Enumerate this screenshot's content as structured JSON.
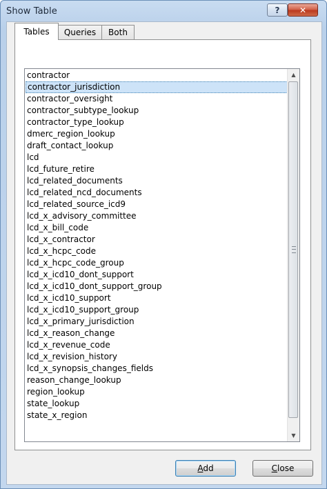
{
  "window": {
    "title": "Show Table",
    "help_glyph": "?",
    "close_glyph": "✕"
  },
  "tabs": [
    {
      "label": "Tables",
      "active": true
    },
    {
      "label": "Queries",
      "active": false
    },
    {
      "label": "Both",
      "active": false
    }
  ],
  "list": {
    "selected_index": 1,
    "items": [
      "contractor",
      "contractor_jurisdiction",
      "contractor_oversight",
      "contractor_subtype_lookup",
      "contractor_type_lookup",
      "dmerc_region_lookup",
      "draft_contact_lookup",
      "lcd",
      "lcd_future_retire",
      "lcd_related_documents",
      "lcd_related_ncd_documents",
      "lcd_related_source_icd9",
      "lcd_x_advisory_committee",
      "lcd_x_bill_code",
      "lcd_x_contractor",
      "lcd_x_hcpc_code",
      "lcd_x_hcpc_code_group",
      "lcd_x_icd10_dont_support",
      "lcd_x_icd10_dont_support_group",
      "lcd_x_icd10_support",
      "lcd_x_icd10_support_group",
      "lcd_x_primary_jurisdiction",
      "lcd_x_reason_change",
      "lcd_x_revenue_code",
      "lcd_x_revision_history",
      "lcd_x_synopsis_changes_fields",
      "reason_change_lookup",
      "region_lookup",
      "state_lookup",
      "state_x_region"
    ]
  },
  "buttons": {
    "add_label": "Add",
    "close_label": "Close"
  },
  "icons": {
    "scroll_up": "chevron-up-icon",
    "scroll_down": "chevron-down-icon",
    "help": "help-icon",
    "close": "close-icon"
  }
}
